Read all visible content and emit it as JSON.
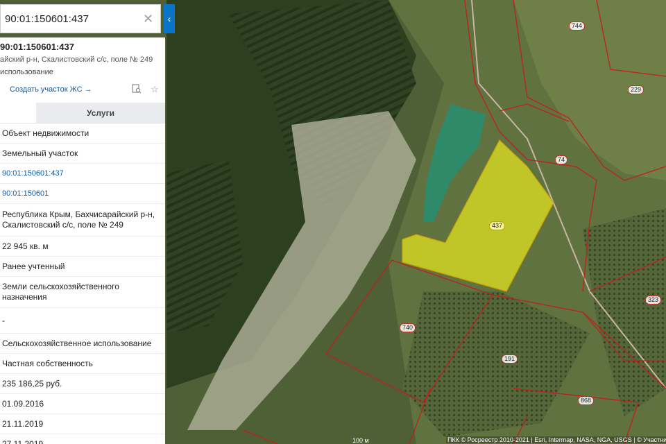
{
  "search": {
    "value": "90:01:150601:437",
    "clear_icon": "close-icon",
    "search_icon": "search-icon",
    "collapse_icon": "chevron-left-icon"
  },
  "panel": {
    "cad_number": "90:01:150601:437",
    "address_short": "айский р-н, Скалистовский с/с, поле № 249",
    "usage_short": "использование",
    "create_link": "Создать участок ЖС",
    "create_link_arrow": "→",
    "tabs": [
      "",
      "Услуги"
    ],
    "rows": [
      {
        "text": "Объект недвижимости"
      },
      {
        "text": "Земельный участок"
      },
      {
        "text": "90:01:150601:437"
      },
      {
        "text": "90:01:150601"
      },
      {
        "text": "Республика Крым, Бахчисарайский р-н, Скалистовский с/с, поле № 249"
      },
      {
        "text": "22 945 кв. м"
      },
      {
        "text": "Ранее учтенный"
      },
      {
        "text": "Земли сельскохозяйственного назначения"
      },
      {
        "text": "-"
      },
      {
        "text": "Сельскохозяйственное использование"
      },
      {
        "text": "Частная собственность"
      },
      {
        "text": "235 186,25 руб."
      },
      {
        "text": "01.09.2016"
      },
      {
        "text": "21.11.2019"
      },
      {
        "text": "27.11.2019"
      }
    ]
  },
  "map": {
    "parcel_labels": [
      "744",
      "229",
      "74",
      "437",
      "323",
      "740",
      "191",
      "868"
    ],
    "scale": "100 м",
    "attribution": "ПКК © Росреестр 2010-2021 | Esri, Intermap, NASA, NGA, USGS | © Участни",
    "colors": {
      "selected_fill": "#e6e61e",
      "boundary": "#c0201c",
      "pond": "#2f8a6a"
    }
  }
}
